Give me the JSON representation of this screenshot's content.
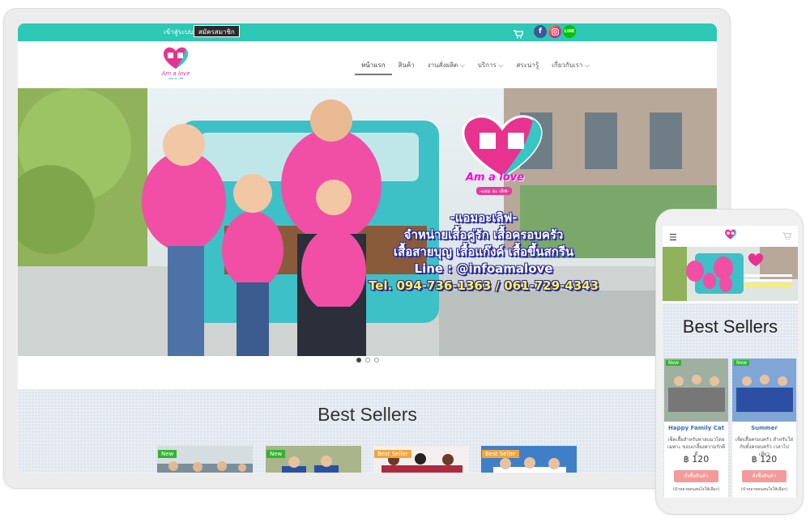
{
  "topbar": {
    "login_label": "เข้าสู่ระบบ",
    "register_label": "สมัครสมาชิก",
    "accent_color": "#2ec8b6"
  },
  "brand": {
    "logo_text": "Am a love",
    "logo_sub": "แอม อะ เลิฟ"
  },
  "nav": {
    "items": [
      {
        "label": "หน้าแรก"
      },
      {
        "label": "สินค้า"
      },
      {
        "label": "งานสั่งผลิต ⌵"
      },
      {
        "label": "บริการ ⌵"
      },
      {
        "label": "สระน่ารู้"
      },
      {
        "label": "เกี่ยวกับเรา ⌵"
      }
    ]
  },
  "hero": {
    "logo_text": "Am a love",
    "logo_sub": "-แอม อะ เลิฟ-",
    "lines": [
      "-แอมอะเลิฟ-",
      "จำหน่ายเสื้อคู่รัก เสื้อครอบครัว",
      "เสื้อสายบุญ เสื้อแก๊งค์ เสื้อขึ้นสกรีน",
      "Line : @infoamalove",
      "Tel. 094-736-1363 / 061-729-4343"
    ]
  },
  "best_sellers": {
    "title": "Best Sellers",
    "products": [
      {
        "badge": "New"
      },
      {
        "badge": "New"
      },
      {
        "badge": "Best Seller"
      },
      {
        "badge": "Best Seller"
      }
    ]
  },
  "mobile": {
    "best_title": "Best Sellers",
    "cards": [
      {
        "badge": "New",
        "name": "Happy Family Cat",
        "desc": "เซ็ตเสื้อสำหรับทาสแมวโดยเฉพาะ ขอบเกลี้ยงความรักดีดี",
        "price": "฿ 120",
        "order": "สั่งซื้อสินค้า",
        "note": "(นำหลายคนสนใจให้เลือก)"
      },
      {
        "badge": "New",
        "name": "Summer",
        "desc": "เซ็ตเสื้อครอบครัว สำหรับใส่กับทั้งครอบครัว เวลาไปเที่ยว",
        "price": "฿ 120",
        "order": "สั่งซื้อสินค้า",
        "note": "(นำหลายคนสนใจให้เลือก)"
      }
    ]
  }
}
